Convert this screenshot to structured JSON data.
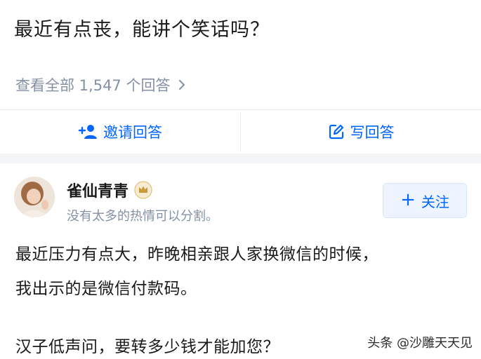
{
  "question": {
    "title": "最近有点丧，能讲个笑话吗？"
  },
  "answers_summary": {
    "view_all_label": "查看全部 1,547 个回答"
  },
  "actions": {
    "invite_label": "邀请回答",
    "write_label": "写回答"
  },
  "author": {
    "name": "雀仙青青",
    "bio": "没有太多的热情可以分割。",
    "follow_label": "关注"
  },
  "answer": {
    "lines": [
      "最近压力有点大，昨晚相亲跟人家换微信的时候，",
      "我出示的是微信付款码。",
      "汉子低声问，要转多少钱才能加您？"
    ]
  },
  "watermark": {
    "text": "头条 @沙雕天天见"
  },
  "colors": {
    "accent": "#0066ff",
    "secondary_text": "#8590a6",
    "primary_text": "#1a1a1a",
    "band": "#f4f5f7",
    "follow_bg": "#eef4ff"
  },
  "icons": {
    "view_all": "chevron-right-icon",
    "invite": "add-user-icon",
    "write": "edit-icon",
    "badge": "crown-badge-icon",
    "follow": "plus-icon"
  }
}
